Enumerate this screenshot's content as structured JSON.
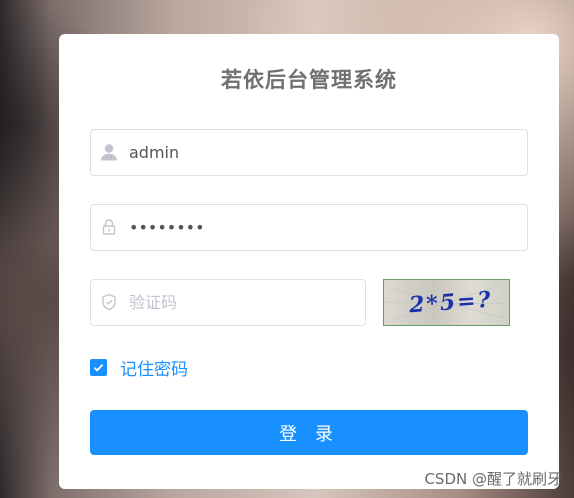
{
  "title": "若依后台管理系统",
  "form": {
    "username": {
      "value": "admin",
      "icon": "user-icon"
    },
    "password": {
      "value": "••••••••",
      "icon": "lock-icon"
    },
    "captcha": {
      "placeholder": "验证码",
      "icon": "shield-icon",
      "image_text": "2*5=?"
    },
    "remember": {
      "label": "记住密码",
      "checked": true
    },
    "submit_label": "登 录"
  },
  "watermark": "CSDN @醒了就刷牙",
  "colors": {
    "primary": "#1890ff",
    "border": "#dcdfe6",
    "placeholder": "#c0c4cc"
  }
}
